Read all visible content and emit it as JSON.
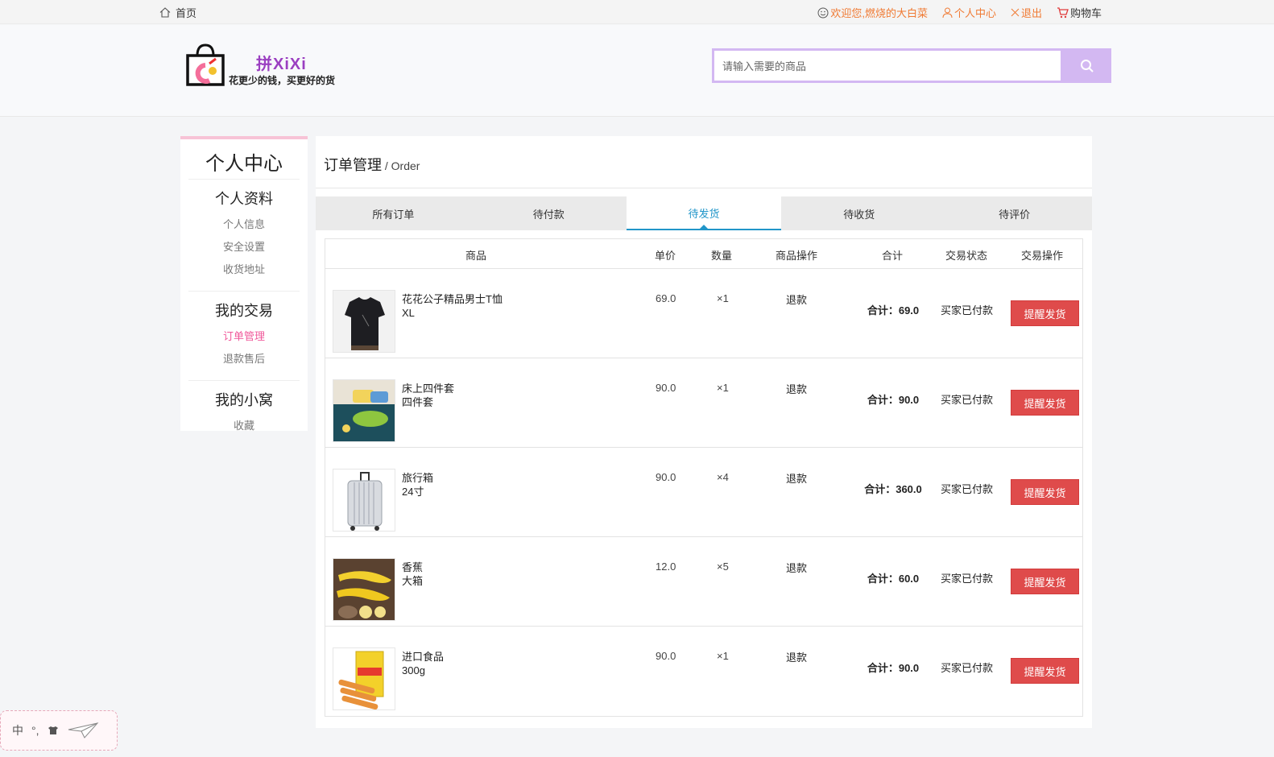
{
  "topbar": {
    "home_label": "首页",
    "welcome": "欢迎您,燃烧的大白菜",
    "personal_center": "个人中心",
    "logout": "退出",
    "cart": "购物车"
  },
  "header": {
    "brand": "拼XiXi",
    "slogan": "花更少的钱，买更好的货",
    "search_placeholder": "请输入需要的商品"
  },
  "sidebar": {
    "title": "个人中心",
    "groups": [
      {
        "heading": "个人资料",
        "items": [
          "个人信息",
          "安全设置",
          "收货地址"
        ]
      },
      {
        "heading": "我的交易",
        "items": [
          "订单管理",
          "退款售后"
        ]
      },
      {
        "heading": "我的小窝",
        "items": [
          "收藏"
        ]
      }
    ]
  },
  "main": {
    "breadcrumb": "订单管理",
    "breadcrumb_sub": " / Order",
    "tabs": [
      "所有订单",
      "待付款",
      "待发货",
      "待收货",
      "待评价"
    ],
    "active_tab": "待发货",
    "columns": {
      "goods": "商品",
      "unit_price": "单价",
      "quantity": "数量",
      "goods_op": "商品操作",
      "total": "合计",
      "status": "交易状态",
      "trade_op": "交易操作"
    },
    "orders": [
      {
        "name": "花花公子精品男士T恤",
        "spec": "XL",
        "price": "69.0",
        "qty": "×1",
        "refund": "退款",
        "total": "合计：69.0",
        "status": "买家已付款",
        "action": "提醒发货",
        "thumb": "tshirt"
      },
      {
        "name": "床上四件套",
        "spec": "四件套",
        "price": "90.0",
        "qty": "×1",
        "refund": "退款",
        "total": "合计：90.0",
        "status": "买家已付款",
        "action": "提醒发货",
        "thumb": "bedding"
      },
      {
        "name": "旅行箱",
        "spec": "24寸",
        "price": "90.0",
        "qty": "×4",
        "refund": "退款",
        "total": "合计：360.0",
        "status": "买家已付款",
        "action": "提醒发货",
        "thumb": "luggage"
      },
      {
        "name": "香蕉",
        "spec": "大箱",
        "price": "12.0",
        "qty": "×5",
        "refund": "退款",
        "total": "合计：60.0",
        "status": "买家已付款",
        "action": "提醒发货",
        "thumb": "banana"
      },
      {
        "name": "进口食品",
        "spec": "300g",
        "price": "90.0",
        "qty": "×1",
        "refund": "退款",
        "total": "合计：90.0",
        "status": "买家已付款",
        "action": "提醒发货",
        "thumb": "snack"
      }
    ]
  },
  "ime": {
    "mode": "中",
    "punct": "°,"
  },
  "colors": {
    "accent_purple": "#d3b8f2",
    "orange": "#f07a33",
    "active_blue": "#2196c9",
    "pink": "#f0589a",
    "button_red": "#df4b4b"
  }
}
